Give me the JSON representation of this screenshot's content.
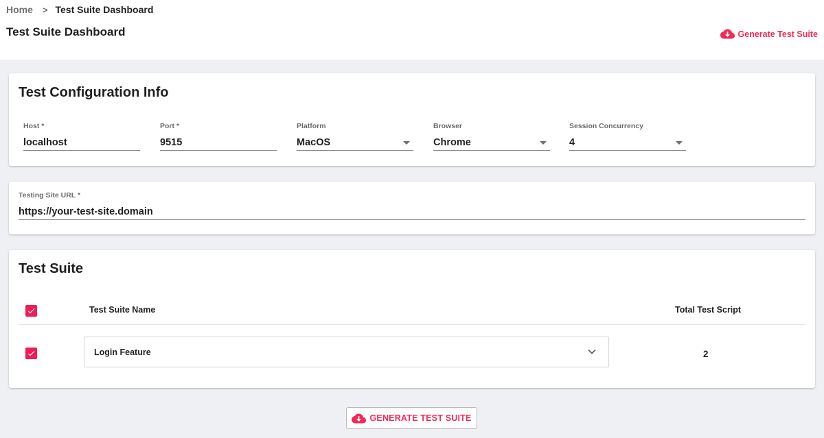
{
  "breadcrumb": {
    "home": "Home",
    "separator": ">",
    "current": "Test Suite Dashboard"
  },
  "page_title": "Test Suite Dashboard",
  "header_action": {
    "label": "Generate Test Suite",
    "icon": "cloud-download-icon"
  },
  "config": {
    "title": "Test Configuration Info",
    "host": {
      "label": "Host *",
      "value": "localhost"
    },
    "port": {
      "label": "Port *",
      "value": "9515"
    },
    "platform": {
      "label": "Platform",
      "value": "MacOS"
    },
    "browser": {
      "label": "Browser",
      "value": "Chrome"
    },
    "concurrency": {
      "label": "Session Concurrency",
      "value": "4"
    }
  },
  "site_url": {
    "label": "Testing Site URL *",
    "value": "https://your-test-site.domain"
  },
  "suite": {
    "title": "Test Suite",
    "columns": {
      "name": "Test Suite Name",
      "total": "Total Test Script"
    },
    "rows": [
      {
        "name": "Login Feature",
        "total": "2",
        "checked": true
      }
    ]
  },
  "footer_action": {
    "label": "GENERATE TEST SUITE",
    "icon": "cloud-download-icon"
  },
  "colors": {
    "accent": "#ef2b56",
    "checkbox": "#ee1d55",
    "background": "#eef0f4"
  }
}
